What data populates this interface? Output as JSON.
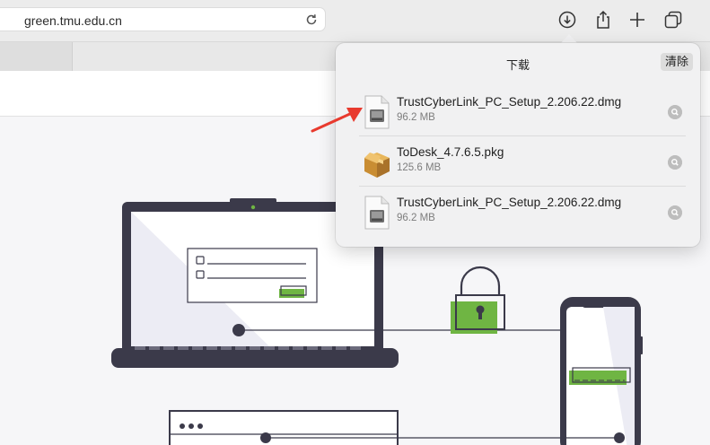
{
  "toolbar": {
    "url": "green.tmu.edu.cn",
    "reload_icon": "reload-icon",
    "icons": [
      "downloads-icon",
      "share-icon",
      "new-tab-plus-icon",
      "tab-overview-icon"
    ]
  },
  "downloads": {
    "title": "下载",
    "clear_label": "清除",
    "items": [
      {
        "name": "TrustCyberLink_PC_Setup_2.206.22.dmg",
        "size": "96.2 MB",
        "icon": "dmg-file-icon"
      },
      {
        "name": "ToDesk_4.7.6.5.pkg",
        "size": "125.6 MB",
        "icon": "pkg-package-icon"
      },
      {
        "name": "TrustCyberLink_PC_Setup_2.206.22.dmg",
        "size": "96.2 MB",
        "icon": "dmg-file-icon"
      }
    ]
  },
  "colors": {
    "illustration_dark": "#3b3a4a",
    "illustration_green": "#6fb543",
    "annotation_red": "#e83a2e"
  }
}
